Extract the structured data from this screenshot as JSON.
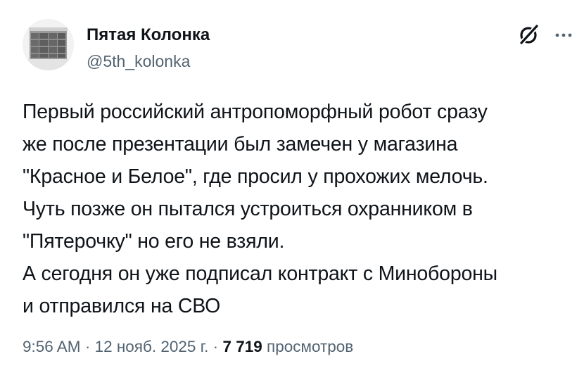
{
  "author": {
    "name": "Пятая Колонка",
    "handle": "@5th_kolonka"
  },
  "tweet": {
    "lines": [
      "Первый российский антропоморфный робот сразу",
      "же после презентации был замечен у магазина",
      "\"Красное и Белое\", где просил у прохожих мелочь.",
      "Чуть позже он пытался устроиться охранником в",
      "\"Пятерочку\" но его не взяли.",
      "А сегодня он уже подписал контракт с Минобороны",
      "и отправился на СВО"
    ]
  },
  "meta": {
    "time": "9:56 AM",
    "separator": "·",
    "date": "12 нояб. 2025 г.",
    "views_count": "7 719",
    "views_label": "просмотров"
  },
  "icons": {
    "grok": "grok-icon",
    "more": "more-icon"
  },
  "colors": {
    "text_primary": "#0f1419",
    "text_secondary": "#536471",
    "background": "#ffffff"
  }
}
